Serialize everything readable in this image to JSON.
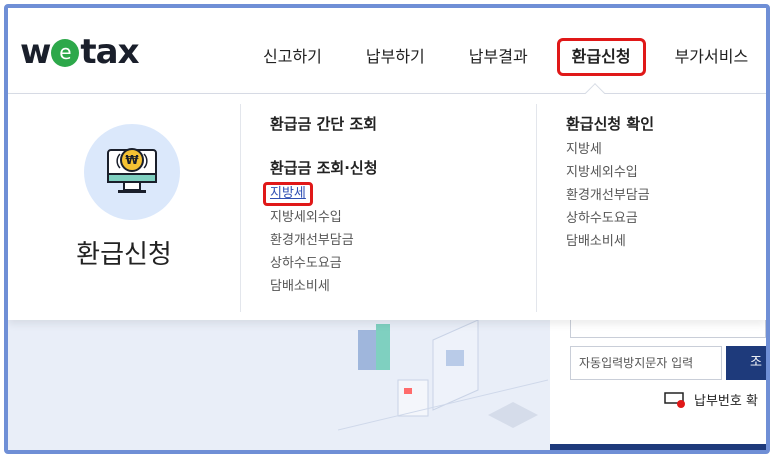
{
  "header": {
    "logo": {
      "prefix": "w",
      "circle": "e",
      "suffix": "tax"
    },
    "nav": [
      {
        "label": "신고하기"
      },
      {
        "label": "납부하기"
      },
      {
        "label": "납부결과"
      },
      {
        "label": "환급신청",
        "active": true
      },
      {
        "label": "부가서비스"
      }
    ]
  },
  "menu": {
    "title": "환급신청",
    "icon": "refund-monitor-icon",
    "columns": [
      {
        "sections": [
          {
            "heading": "환급금 간단 조회",
            "items": []
          },
          {
            "heading": "환급금 조회·신청",
            "items": [
              "지방세",
              "지방세외수입",
              "환경개선부담금",
              "상하수도요금",
              "담배소비세"
            ]
          }
        ],
        "highlighted_item": "지방세"
      },
      {
        "sections": [
          {
            "heading": "환급신청 확인",
            "items": [
              "지방세",
              "지방세외수입",
              "환경개선부담금",
              "상하수도요금",
              "담배소비세"
            ]
          }
        ]
      }
    ]
  },
  "background": {
    "captcha_placeholder": "자동입력방지문자 입력",
    "lookup_button": "조",
    "payment_number_link": "납부번호 확"
  },
  "colors": {
    "frame": "#6f8fd6",
    "highlight": "#e01818",
    "accent": "#1e3a7b",
    "logo_green": "#2da84a",
    "icon_bg": "#dbe8fb"
  }
}
